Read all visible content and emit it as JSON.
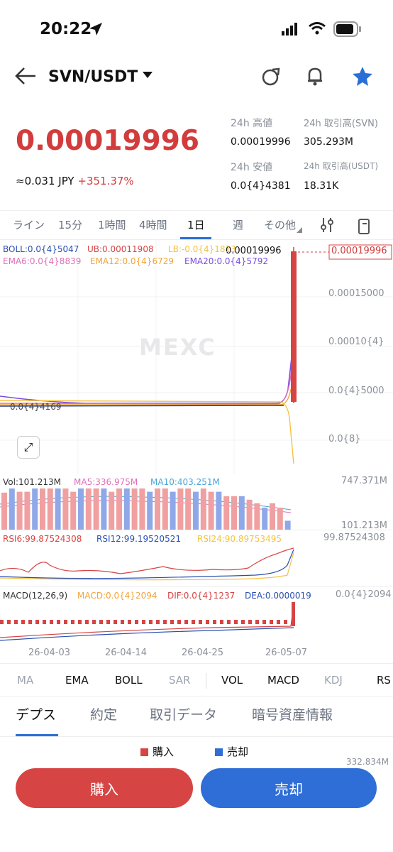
{
  "status": {
    "time": "20:22"
  },
  "header": {
    "pair": "SVN/USDT"
  },
  "ticker": {
    "price": "0.00019996",
    "jpy": "≈0.031 JPY",
    "change": "+351.37%",
    "high_label": "24h 高値",
    "high": "0.00019996",
    "low_label": "24h 安値",
    "low": "0.0{4}4381",
    "vol_svn_label": "24h 取引高(SVN)",
    "vol_svn": "305.293M",
    "vol_usdt_label": "24h 取引高(USDT)",
    "vol_usdt": "18.31K"
  },
  "tabs": [
    "ライン",
    "15分",
    "1時間",
    "4時間",
    "1日",
    "週",
    "その他"
  ],
  "indicators": {
    "boll": "BOLL:0.0{4}5047",
    "ub": "UB:0.00011908",
    "lb": "LB:-0.0{4}1813",
    "ema6": "EMA6:0.0{4}8839",
    "ema12": "EMA12:0.0{4}6729",
    "ema20": "EMA20:0.0{4}5792",
    "vol": "Vol:101.213M",
    "ma5": "MA5:336.975M",
    "ma10": "MA10:403.251M",
    "rsi6": "RSI6:99.87524308",
    "rsi12": "RSI12:99.19520521",
    "rsi24": "RSI24:90.89753495",
    "macd_label": "MACD(12,26,9)",
    "macd": "MACD:0.0{4}2094",
    "dif": "DIF:0.0{4}1237",
    "dea": "DEA:0.0000019"
  },
  "price_axis": [
    "0.00019996",
    "0.00015000",
    "0.00010{4}",
    "0.0{4}5000",
    "0.0{8}"
  ],
  "price_tag": "0.00019996",
  "price_tag_left": "0.00019996",
  "min_label": "0.0{4}4169",
  "vol_axis": [
    "747.371M",
    "101.213M"
  ],
  "rsi_axis": "99.87524308",
  "macd_axis": "0.0{4}2094",
  "dates": [
    "26-04-03",
    "26-04-14",
    "26-04-25",
    "26-05-07"
  ],
  "watermark": "MEXC",
  "bottom_tabs": [
    "MA",
    "EMA",
    "BOLL",
    "SAR",
    "VOL",
    "MACD",
    "KDJ",
    "RS"
  ],
  "detail_tabs": [
    "デプス",
    "約定",
    "取引データ",
    "暗号資産情報"
  ],
  "legend": {
    "buy": "購入",
    "sell": "売却",
    "cut": "332.834M"
  },
  "buttons": {
    "buy": "購入",
    "sell": "売却"
  },
  "colors": {
    "up": "#d64444",
    "down": "#2e6ed6",
    "accent": "#2a6fd6"
  },
  "chart_data": {
    "type": "bar",
    "volume_values_M": [
      420,
      560,
      430,
      430,
      520,
      560,
      470,
      520,
      470,
      430,
      520,
      500,
      520,
      470,
      430,
      520,
      560,
      470,
      520,
      430,
      520,
      470,
      430,
      520,
      470,
      430,
      520,
      430,
      430,
      380,
      380,
      380,
      340,
      300,
      250,
      300,
      250,
      101.213
    ]
  }
}
